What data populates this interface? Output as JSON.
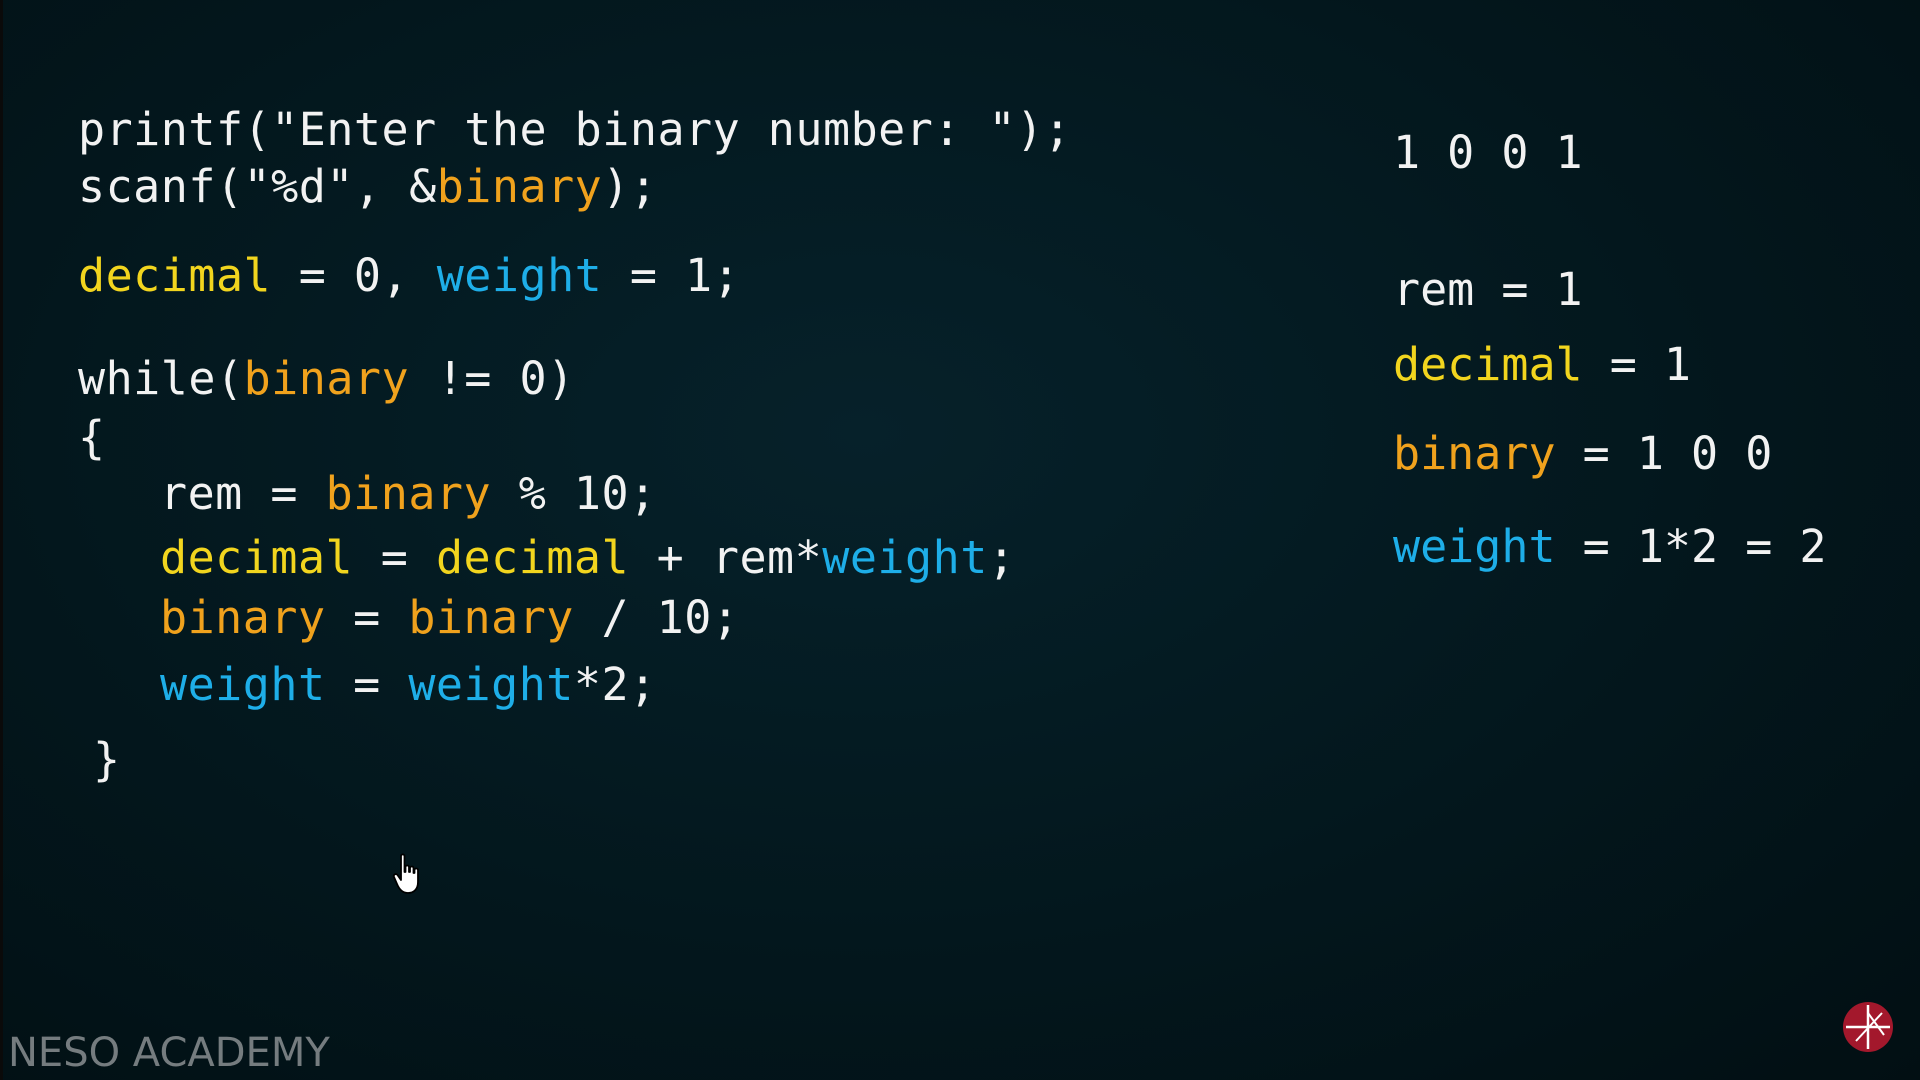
{
  "code": {
    "l1": "printf(\"Enter the binary number: \");",
    "l2a": "scanf(\"%d\", &",
    "l2b": "binary",
    "l2c": ");",
    "l3a": "decimal",
    "l3b": " = 0, ",
    "l3c": "weight",
    "l3d": " = 1;",
    "l4a": "while(",
    "l4b": "binary",
    "l4c": " != 0)",
    "l5": "{",
    "l6a": "rem = ",
    "l6b": "binary",
    "l6c": " % 10;",
    "l7a": "decimal",
    "l7b": " = ",
    "l7c": "decimal",
    "l7d": " + rem*",
    "l7e": "weight",
    "l7f": ";",
    "l8a": "binary",
    "l8b": " = ",
    "l8c": "binary",
    "l8d": " / 10;",
    "l9a": "weight",
    "l9b": " = ",
    "l9c": "weight",
    "l9d": "*2;",
    "l10": "}"
  },
  "trace": {
    "input": "1 0 0 1",
    "rem_label": "rem",
    "rem_value": " = 1",
    "decimal_label": "decimal",
    "decimal_value": " = 1",
    "binary_label": "binary",
    "binary_value": " = 1 0 0",
    "weight_label": "weight",
    "weight_value": " = 1*2 = 2"
  },
  "brand": {
    "name": "NESO ACADEMY",
    "logo_icon": "neso-logo-icon"
  },
  "colors": {
    "background": "#03151a",
    "text": "#f2f2f2",
    "decimal": "#f2d51e",
    "binary": "#f0a21d",
    "weight": "#1eaee8"
  }
}
